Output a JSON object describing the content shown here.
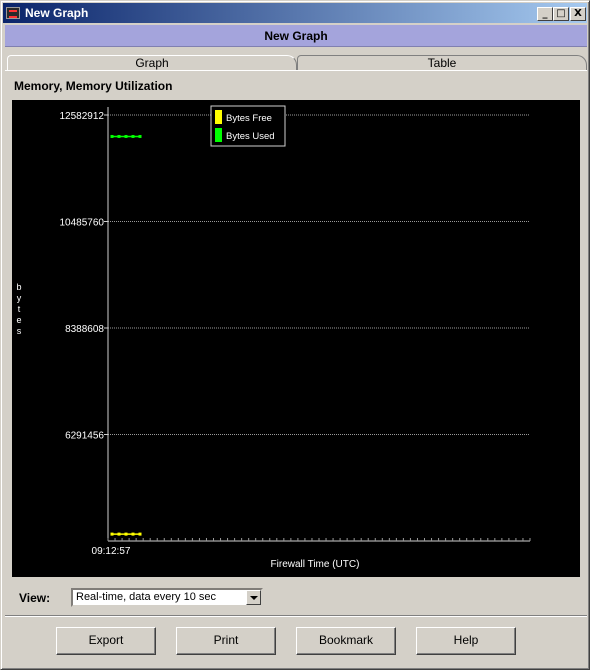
{
  "window": {
    "title": "New Graph",
    "controls": {
      "minimize": "_",
      "maximize": "□",
      "close": "X"
    }
  },
  "header": {
    "title": "New Graph"
  },
  "tabs": [
    {
      "label": "Graph",
      "active": true
    },
    {
      "label": "Table",
      "active": false
    }
  ],
  "section_title": "Memory, Memory Utilization",
  "chart_data": {
    "type": "line",
    "title": "",
    "xlabel": "Firewall Time (UTC)",
    "ylabel": "bytes",
    "y_ticks": [
      "12582912",
      "10485760",
      "8388608",
      "6291456"
    ],
    "y_tick_values": [
      12582912,
      10485760,
      8388608,
      6291456
    ],
    "x_ticks": [
      "09:12:57"
    ],
    "ylim": [
      4194304,
      12582912
    ],
    "grid": true,
    "legend_placement": "top-left",
    "background": "#000000",
    "series": [
      {
        "name": "Bytes Free",
        "color": "#ffff00",
        "values": [
          4330000,
          4330000,
          4330000,
          4330000,
          4330000
        ]
      },
      {
        "name": "Bytes Used",
        "color": "#00ff00",
        "values": [
          12160000,
          12160000,
          12160000,
          12160000,
          12160000
        ]
      }
    ]
  },
  "view": {
    "label": "View:",
    "selected": "Real-time, data every 10 sec"
  },
  "buttons": {
    "export": "Export",
    "print": "Print",
    "bookmark": "Bookmark",
    "help": "Help"
  }
}
